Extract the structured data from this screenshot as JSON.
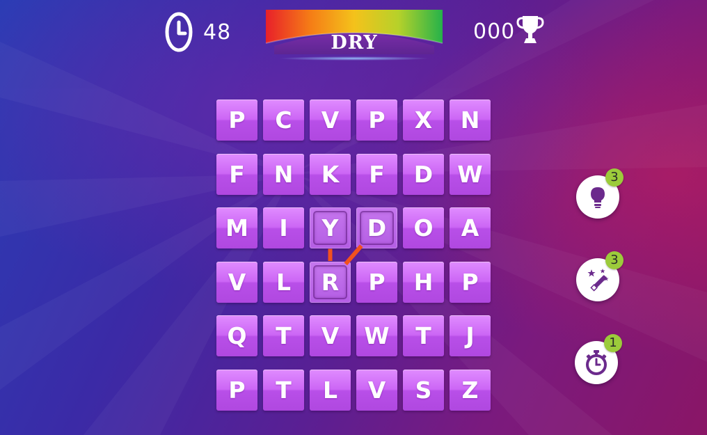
{
  "hud": {
    "timer_value": "48",
    "current_word": "DRY",
    "score_value": "000"
  },
  "grid": {
    "rows": [
      [
        "P",
        "C",
        "V",
        "P",
        "X",
        "N"
      ],
      [
        "F",
        "N",
        "K",
        "F",
        "D",
        "W"
      ],
      [
        "M",
        "I",
        "Y",
        "D",
        "O",
        "A"
      ],
      [
        "V",
        "L",
        "R",
        "P",
        "H",
        "P"
      ],
      [
        "Q",
        "T",
        "V",
        "W",
        "T",
        "J"
      ],
      [
        "P",
        "T",
        "L",
        "V",
        "S",
        "Z"
      ]
    ],
    "selected_path": [
      [
        2,
        3
      ],
      [
        3,
        2
      ],
      [
        2,
        2
      ]
    ]
  },
  "powerups": [
    {
      "name": "hint",
      "icon": "lightbulb-icon",
      "count": "3"
    },
    {
      "name": "magic",
      "icon": "magic-wand-icon",
      "count": "3"
    },
    {
      "name": "time",
      "icon": "stopwatch-icon",
      "count": "1"
    }
  ],
  "colors": {
    "tile": "#cc66f5",
    "link": "#f2521e",
    "badge": "#9ccb3b",
    "icon": "#6b2a8c"
  }
}
